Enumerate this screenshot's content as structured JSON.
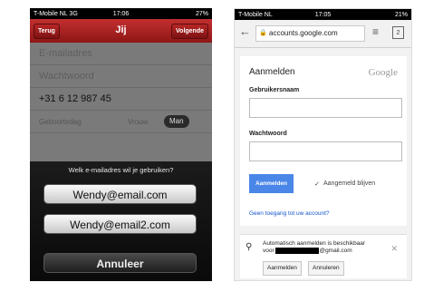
{
  "left_phone": {
    "status": {
      "carrier": "T-Mobile NL 3G",
      "time": "17:06",
      "battery": "27%"
    },
    "nav": {
      "back": "Terug",
      "title": "Jij",
      "next": "Volgende"
    },
    "fields": {
      "email_placeholder": "E-mailadres",
      "password_placeholder": "Wachtwoord",
      "phone_value": "+31 6 12 987 45",
      "birthday_label": "Geboortedag",
      "gender_female": "Vrouw",
      "gender_male": "Man"
    },
    "sheet": {
      "question": "Welk e-mailadres wil je gebruiken?",
      "options": [
        "Wendy@email.com",
        "Wendy@email2.com"
      ],
      "cancel": "Annuleer"
    }
  },
  "right_phone": {
    "status": {
      "carrier": "T-Mobile NL",
      "time": "17:05",
      "battery": "21%"
    },
    "browser": {
      "url": "accounts.google.com",
      "tabs_count": "2"
    },
    "signin": {
      "heading": "Aanmelden",
      "logo": "Google",
      "username_label": "Gebruikersnaam",
      "password_label": "Wachtwoord",
      "button": "Aanmelden",
      "stay_signed_in": "Aangemeld blijven",
      "forgot_link": "Geen toegang tot uw account?"
    },
    "autologin": {
      "message_line1": "Automatisch aanmelden is beschikbaar",
      "message_prefix": "voor",
      "message_suffix": "@gmail.com",
      "accept": "Aanmelden",
      "decline": "Annuleren"
    }
  }
}
